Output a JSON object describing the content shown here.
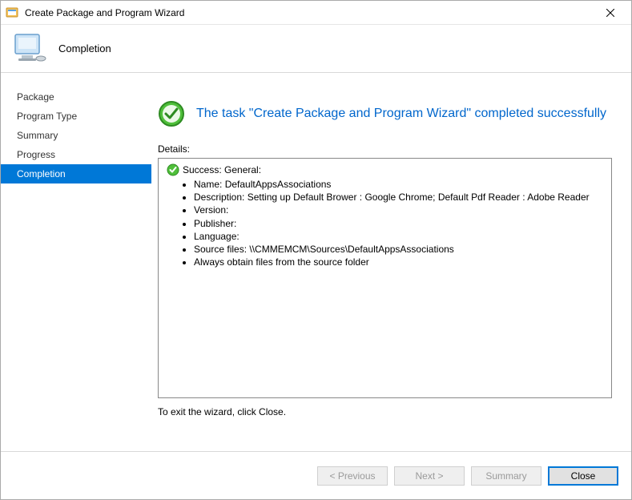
{
  "titlebar": {
    "title": "Create Package and Program Wizard"
  },
  "header": {
    "title": "Completion"
  },
  "sidebar": {
    "items": [
      {
        "label": "Package",
        "active": false
      },
      {
        "label": "Program Type",
        "active": false
      },
      {
        "label": "Summary",
        "active": false
      },
      {
        "label": "Progress",
        "active": false
      },
      {
        "label": "Completion",
        "active": true
      }
    ]
  },
  "main": {
    "success_message": "The task \"Create Package and Program Wizard\" completed successfully",
    "details_label": "Details:",
    "detail_header": "Success: General:",
    "details": [
      {
        "key": "Name",
        "value": "DefaultAppsAssociations"
      },
      {
        "key": "Description",
        "value": "Setting up Default Brower : Google Chrome; Default Pdf Reader : Adobe Reader"
      },
      {
        "key": "Version",
        "value": ""
      },
      {
        "key": "Publisher",
        "value": ""
      },
      {
        "key": "Language",
        "value": ""
      },
      {
        "key": "Source files",
        "value": "\\\\CMMEMCM\\Sources\\DefaultAppsAssociations"
      },
      {
        "text": "Always obtain files from the source folder"
      }
    ],
    "exit_text": "To exit the wizard, click Close."
  },
  "footer": {
    "buttons": {
      "previous": "< Previous",
      "next": "Next >",
      "summary": "Summary",
      "close": "Close"
    }
  }
}
